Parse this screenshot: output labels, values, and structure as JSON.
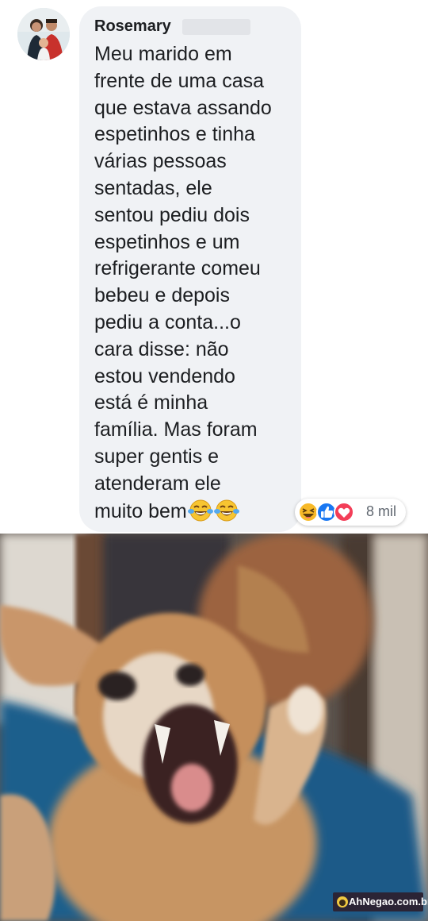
{
  "comment": {
    "author": "Rosemary",
    "text_lines": [
      "Meu marido em",
      "frente de uma casa",
      "que estava assando",
      "espetinhos e tinha",
      "várias pessoas",
      "sentadas, ele",
      "sentou pediu dois",
      "espetinhos e um",
      "refrigerante comeu",
      "bebeu e depois",
      "pediu a conta...o",
      "cara disse: não",
      "estou vendendo",
      "está é minha",
      "família. Mas foram",
      "super gentis e",
      "atenderam ele"
    ],
    "last_line": "muito bem",
    "emoji": [
      "tears-of-joy-icon",
      "tears-of-joy-icon"
    ]
  },
  "reactions": {
    "icons": [
      "haha-reaction-icon",
      "like-reaction-icon",
      "love-reaction-icon"
    ],
    "count": "8 mil"
  },
  "watermark": {
    "text": "AhNegao.com.br"
  },
  "colors": {
    "bubble": "#f0f2f5",
    "text": "#1c1e21",
    "like_blue": "#1877f2",
    "love_red": "#f33e58",
    "haha_yellow": "#f7b928"
  }
}
